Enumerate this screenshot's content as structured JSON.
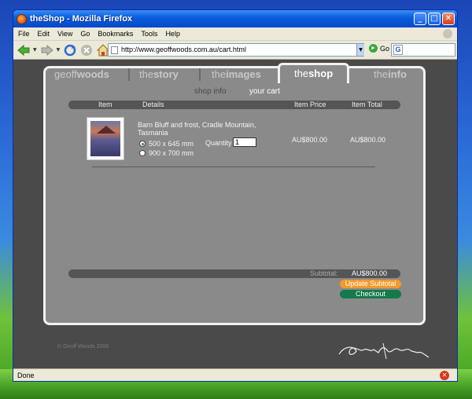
{
  "window": {
    "title": "theShop - Mozilla Firefox",
    "minimize": "_",
    "maximize": "□",
    "close": "✕"
  },
  "menu": [
    "File",
    "Edit",
    "View",
    "Go",
    "Bookmarks",
    "Tools",
    "Help"
  ],
  "navbar": {
    "url": "http://www.geoffwoods.com.au/cart.html",
    "go_label": "Go",
    "search_icon_letter": "G"
  },
  "site": {
    "tabs": [
      {
        "light": "geoff",
        "bold": "woods"
      },
      {
        "light": "the",
        "bold": "story"
      },
      {
        "light": "the",
        "bold": "images"
      },
      {
        "light": "the",
        "bold": "shop"
      },
      {
        "light": "the",
        "bold": "info"
      }
    ],
    "active_tab": "theshop",
    "subtabs": [
      "shop info",
      "your cart"
    ],
    "current_subtab": "your cart",
    "table_headers": [
      "Item",
      "Details",
      "Item Price",
      "Item Total"
    ],
    "product": {
      "name": "Barn Bluff and frost, Cradle Mountain, Tasmania",
      "sizes": [
        "500 x 645 mm",
        "900 x 700 mm"
      ],
      "selected_size": "500 x 645 mm",
      "quantity_label": "Quantity",
      "quantity": "1",
      "item_price": "AU$800.00",
      "item_total": "AU$800.00"
    },
    "subtotal_label": "Subtotal:",
    "subtotal_value": "AU$800.00",
    "update_button": "Update Subtotal",
    "checkout_button": "Checkout",
    "copyright": "© Geoff Woods 2006"
  },
  "status": {
    "text": "Done"
  },
  "colors": {
    "update_button": "#f39a2c",
    "checkout_button": "#137a4a",
    "page_bg": "#8a8a8a"
  }
}
